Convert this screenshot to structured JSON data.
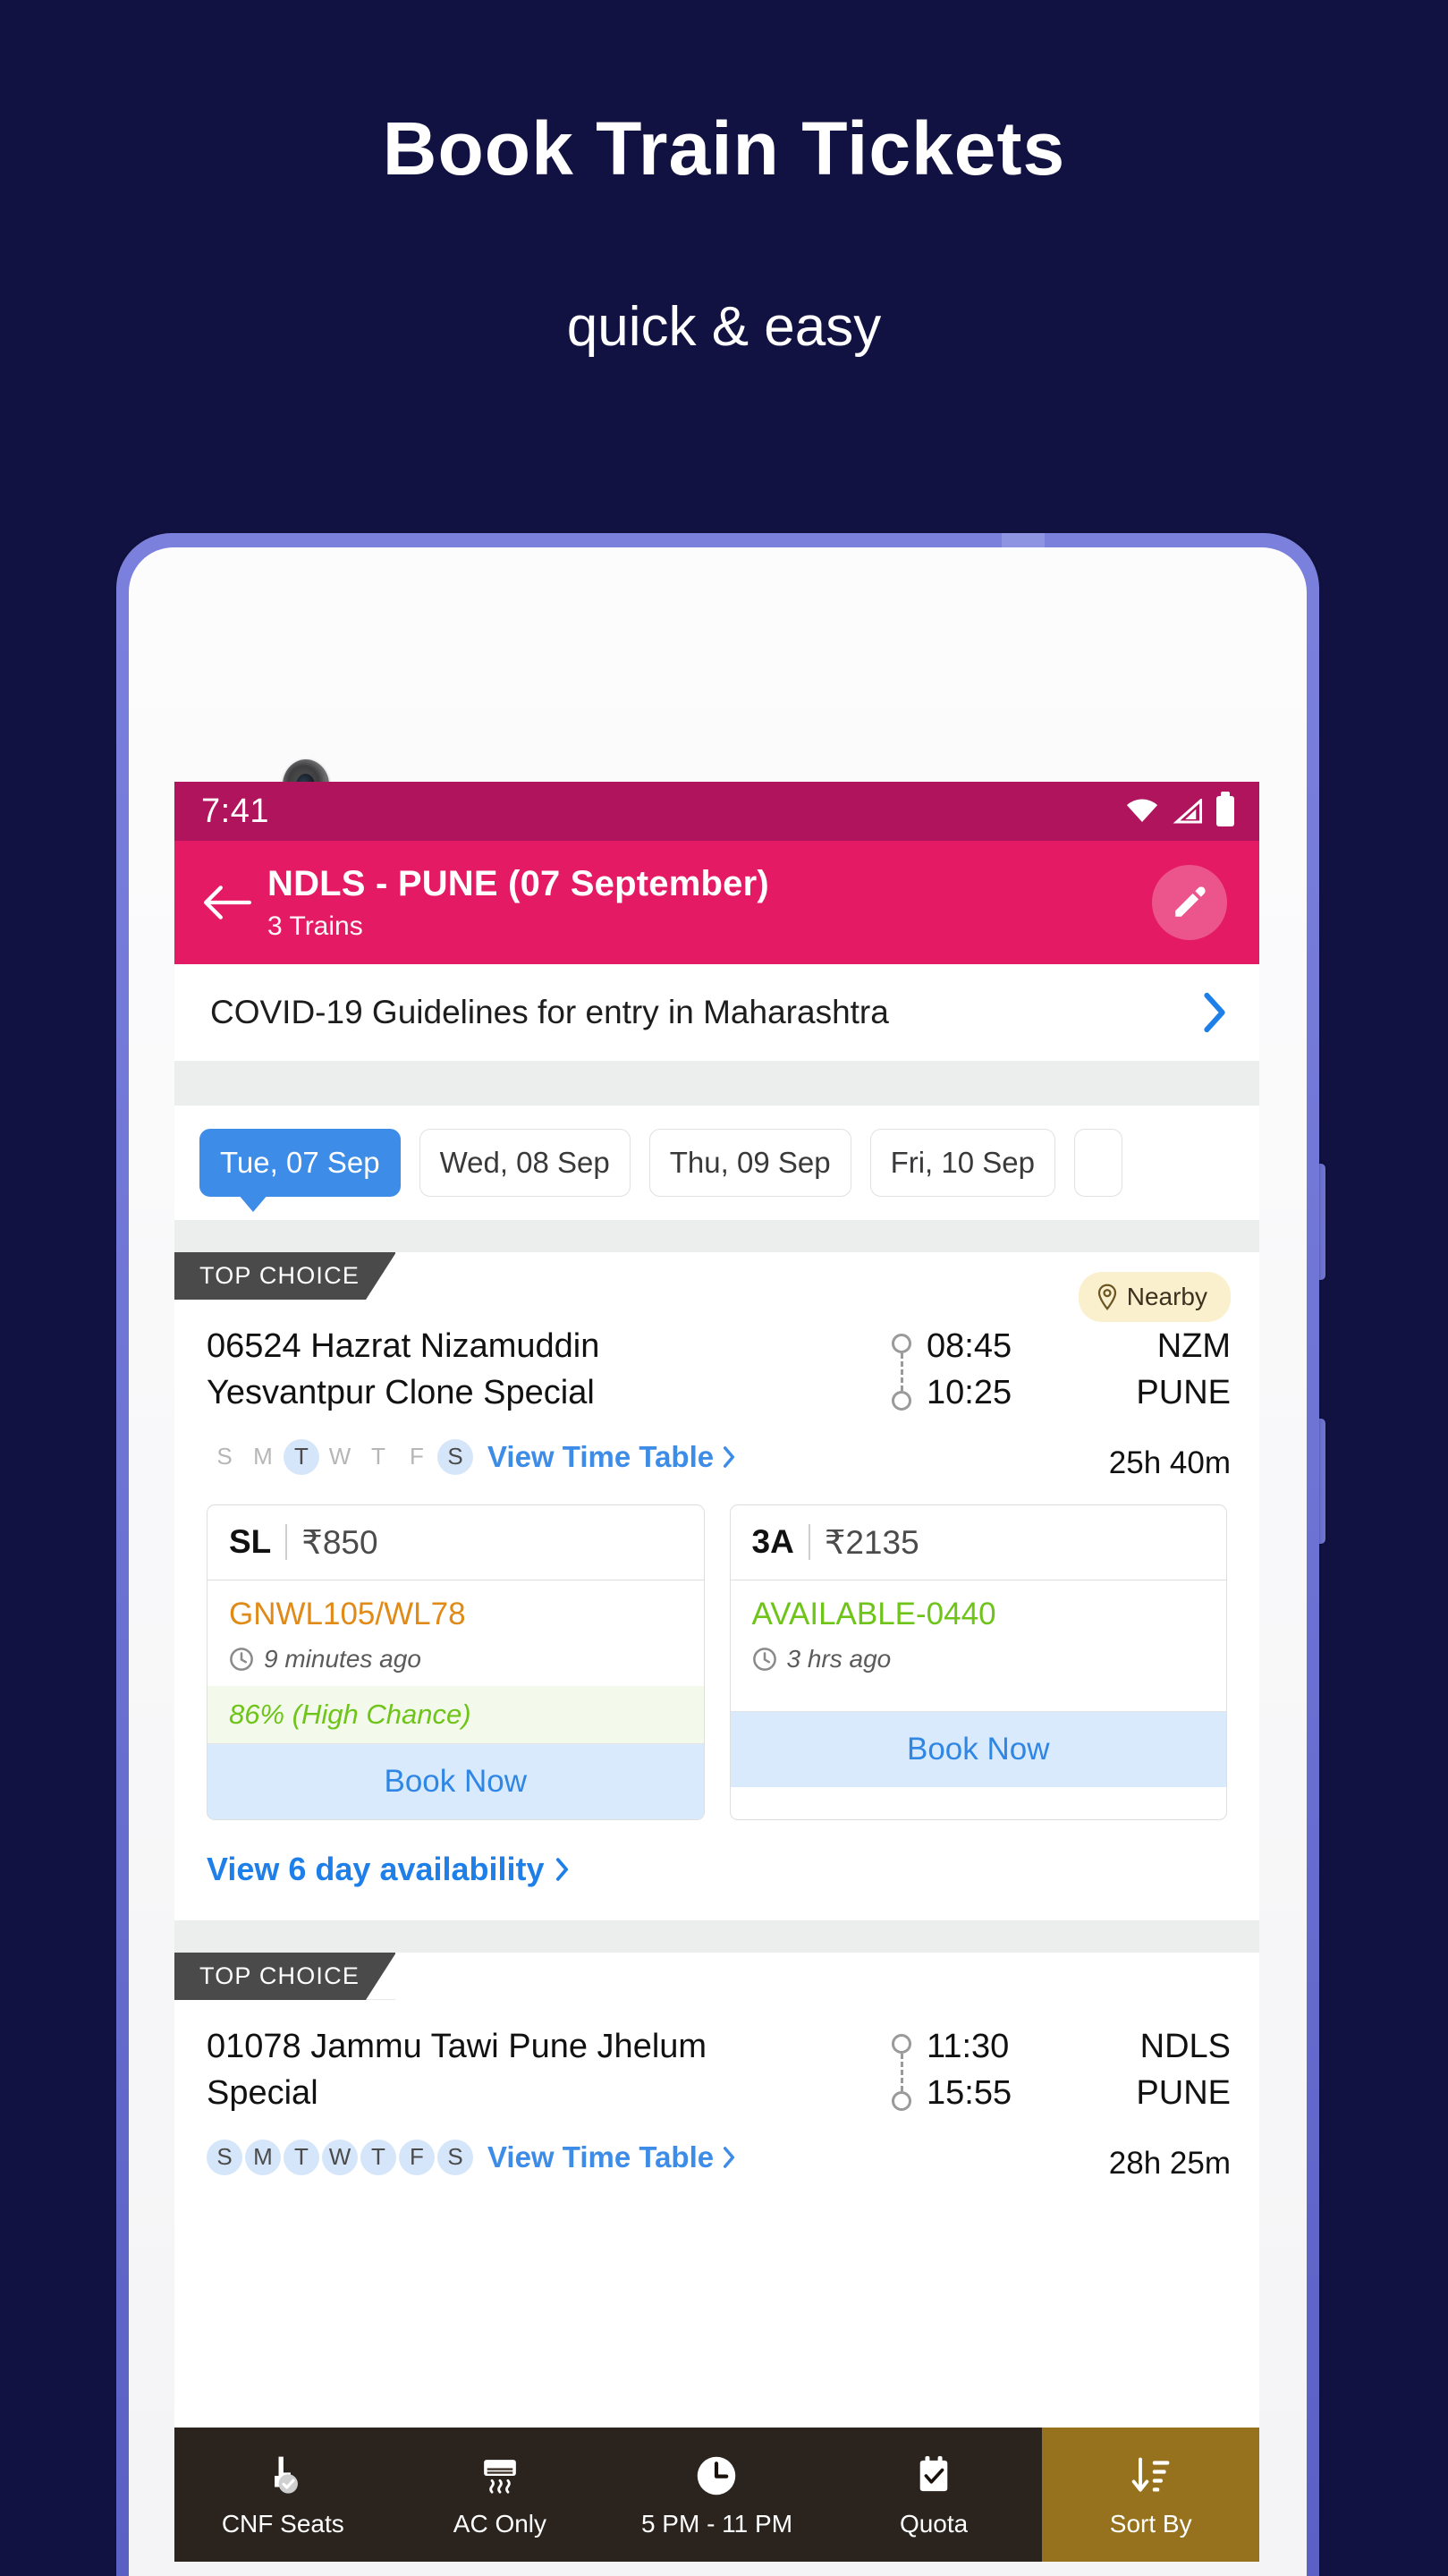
{
  "promo": {
    "title": "Book Train Tickets",
    "subtitle": "quick & easy",
    "bg_color": "#121242"
  },
  "statusbar": {
    "time": "7:41",
    "bg_color": "#b0145d",
    "icons": [
      "wifi-icon",
      "signal-icon",
      "battery-icon"
    ]
  },
  "appbar": {
    "back_icon": "back-arrow-icon",
    "title": "NDLS - PUNE (07 September)",
    "subtitle": "3 Trains",
    "edit_icon": "edit-pencil-icon",
    "bg_color": "#e51a64"
  },
  "covid_banner": {
    "text": "COVID-19 Guidelines for entry in Maharashtra",
    "chevron": "chevron-right-icon"
  },
  "date_tabs": {
    "selected_index": 0,
    "items": [
      {
        "label": "Tue, 07 Sep",
        "selected": true
      },
      {
        "label": "Wed, 08 Sep",
        "selected": false
      },
      {
        "label": "Thu, 09 Sep",
        "selected": false
      },
      {
        "label": "Fri, 10 Sep",
        "selected": false
      }
    ],
    "selected_color": "#3d8ce8"
  },
  "trains": [
    {
      "ribbon": "TOP CHOICE",
      "nearby_badge": "Nearby",
      "name_line1": "06524 Hazrat Nizamuddin",
      "name_line2": "Yesvantpur Clone Special",
      "depart_time": "08:45",
      "arrive_time": "10:25",
      "from_station": "NZM",
      "to_station": "PUNE",
      "duration": "25h 40m",
      "days": [
        {
          "label": "S",
          "active": false
        },
        {
          "label": "M",
          "active": false
        },
        {
          "label": "T",
          "active": true
        },
        {
          "label": "W",
          "active": false
        },
        {
          "label": "T",
          "active": false
        },
        {
          "label": "F",
          "active": false
        },
        {
          "label": "S",
          "active": true
        }
      ],
      "time_table_link": "View Time Table",
      "fares": [
        {
          "class": "SL",
          "price": "₹850",
          "status": "GNWL105/WL78",
          "status_color": "#e08a17",
          "updated": "9 minutes ago",
          "chance": "86% (High Chance)",
          "book_label": "Book Now"
        },
        {
          "class": "3A",
          "price": "₹2135",
          "status": "AVAILABLE-0440",
          "status_color": "#6fc41a",
          "updated": "3 hrs ago",
          "chance": "",
          "book_label": "Book Now"
        }
      ],
      "availability_link": "View 6 day availability"
    },
    {
      "ribbon": "TOP CHOICE",
      "name_line1": "01078 Jammu Tawi Pune Jhelum",
      "name_line2": "Special",
      "depart_time": "11:30",
      "arrive_time": "15:55",
      "from_station": "NDLS",
      "to_station": "PUNE",
      "duration": "28h 25m",
      "days": [
        {
          "label": "S",
          "active": true
        },
        {
          "label": "M",
          "active": true
        },
        {
          "label": "T",
          "active": true
        },
        {
          "label": "W",
          "active": true
        },
        {
          "label": "T",
          "active": true
        },
        {
          "label": "F",
          "active": true
        },
        {
          "label": "S",
          "active": true
        }
      ],
      "time_table_link": "View Time Table"
    }
  ],
  "filter_bar": {
    "bg_color": "#19110b",
    "selected_color": "#96721f",
    "items": [
      {
        "label": "CNF Seats",
        "icon": "cnf-seat-icon",
        "selected": false
      },
      {
        "label": "AC Only",
        "icon": "ac-unit-icon",
        "selected": false
      },
      {
        "label": "5 PM - 11 PM",
        "icon": "clock-icon",
        "selected": false
      },
      {
        "label": "Quota",
        "icon": "quota-calendar-icon",
        "selected": false
      },
      {
        "label": "Sort By",
        "icon": "sort-descending-icon",
        "selected": true
      }
    ]
  }
}
